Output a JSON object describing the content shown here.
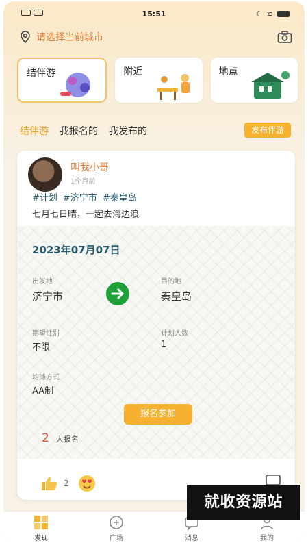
{
  "status": {
    "time": "15:51"
  },
  "location": {
    "text": "请选择当前城市"
  },
  "cards": [
    {
      "label": "结伴游",
      "active": true
    },
    {
      "label": "附近",
      "active": false
    },
    {
      "label": "地点",
      "active": false
    }
  ],
  "tabs": [
    {
      "label": "结伴游",
      "active": true
    },
    {
      "label": "我报名的",
      "active": false
    },
    {
      "label": "我发布的",
      "active": false
    }
  ],
  "publish_label": "发布伴游",
  "post": {
    "author": "叫我小哥",
    "time_ago": "1个月前",
    "tags": [
      "#计划",
      "#济宁市",
      "#秦皇岛"
    ],
    "description": "七月七日晴，一起去海边浪",
    "date": "2023年07月07日",
    "departure_label": "出发地",
    "departure": "济宁市",
    "destination_label": "目的地",
    "destination": "秦皇岛",
    "gender_label": "期望性别",
    "gender": "不限",
    "people_label": "计划人数",
    "people": "1",
    "cost_label": "均摊方式",
    "cost": "AA制",
    "join_label": "报名参加",
    "signup_count": "2",
    "signup_label": "人报名",
    "like_count": "2"
  },
  "watermark": "就收资源站",
  "nav": [
    {
      "label": "发现",
      "icon": "discover-icon",
      "active": true
    },
    {
      "label": "广场",
      "icon": "square-icon",
      "active": false
    },
    {
      "label": "消息",
      "icon": "message-icon",
      "active": false
    },
    {
      "label": "我的",
      "icon": "profile-icon",
      "active": false
    }
  ],
  "colors": {
    "accent": "#f6b130",
    "orange_text": "#e2772f",
    "teal_text": "#245a6b",
    "green": "#1ea138"
  }
}
